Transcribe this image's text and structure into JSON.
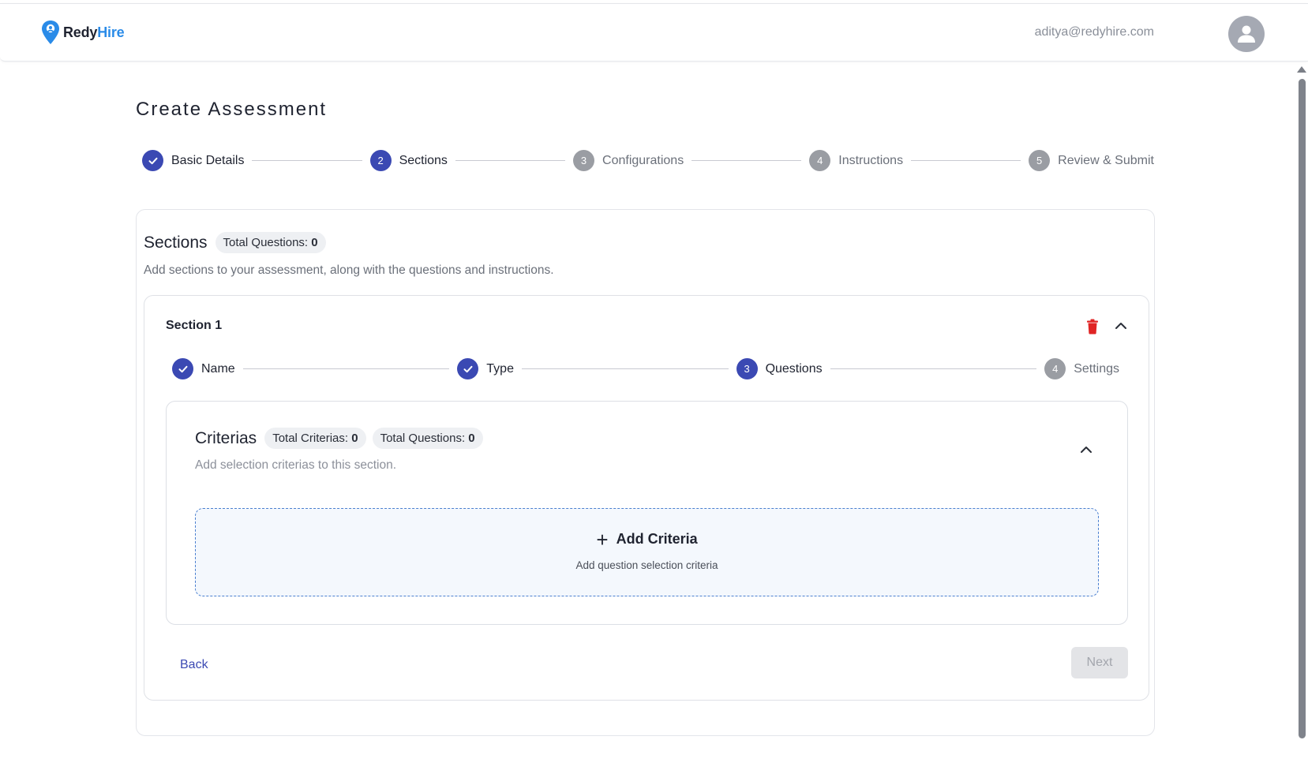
{
  "header": {
    "brand_part1": "Redy",
    "brand_part2": "Hire",
    "user_email": "aditya@redyhire.com",
    "brand_color": "#2a8be8"
  },
  "page": {
    "title": "Create Assessment"
  },
  "main_stepper": [
    {
      "number": "",
      "label": "Basic Details",
      "status": "done"
    },
    {
      "number": "2",
      "label": "Sections",
      "status": "active"
    },
    {
      "number": "3",
      "label": "Configurations",
      "status": "pending"
    },
    {
      "number": "4",
      "label": "Instructions",
      "status": "pending"
    },
    {
      "number": "5",
      "label": "Review & Submit",
      "status": "pending"
    }
  ],
  "sections": {
    "title": "Sections",
    "total_questions_label": "Total Questions:",
    "total_questions_value": "0",
    "subtitle": "Add sections to your assessment, along with the questions and instructions."
  },
  "section": {
    "name": "Section 1",
    "stepper": [
      {
        "number": "",
        "label": "Name",
        "status": "done"
      },
      {
        "number": "",
        "label": "Type",
        "status": "done"
      },
      {
        "number": "3",
        "label": "Questions",
        "status": "active"
      },
      {
        "number": "4",
        "label": "Settings",
        "status": "pending"
      }
    ]
  },
  "criterias": {
    "title": "Criterias",
    "total_criterias_label": "Total Criterias:",
    "total_criterias_value": "0",
    "total_questions_label": "Total Questions:",
    "total_questions_value": "0",
    "subtitle": "Add selection criterias to this section.",
    "add_label": "Add Criteria",
    "add_sublabel": "Add question selection criteria"
  },
  "buttons": {
    "back": "Back",
    "next": "Next"
  },
  "colors": {
    "primary": "#3b49b3",
    "danger": "#e02424",
    "pending": "#9a9da3"
  }
}
